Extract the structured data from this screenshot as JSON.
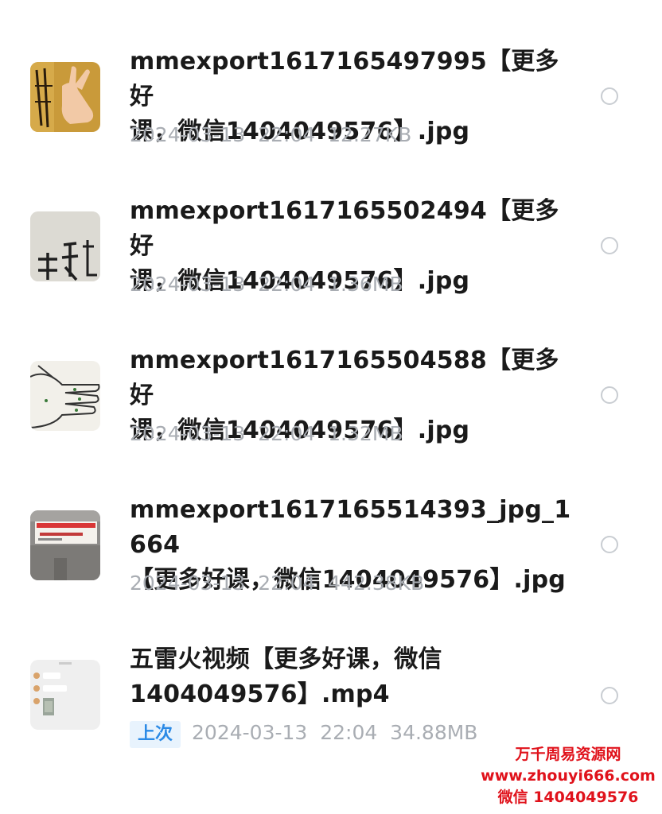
{
  "files": [
    {
      "name_line1": "mmexport1617165497995【更多好",
      "name_line2": "课，微信1404049576】.jpg",
      "date": "2024-03-13",
      "time": "22:04",
      "size": "12.27KB",
      "thumb_icon": "hand-gesture-thumbnail"
    },
    {
      "name_line1": "mmexport1617165502494【更多好",
      "name_line2": "课，微信1404049576】.jpg",
      "date": "2024-03-13",
      "time": "22:04",
      "size": "1.36MB",
      "thumb_icon": "calligraphy-thumbnail"
    },
    {
      "name_line1": "mmexport1617165504588【更多好",
      "name_line2": "课，微信1404049576】.jpg",
      "date": "2024-03-13",
      "time": "22:04",
      "size": "1.32MB",
      "thumb_icon": "hand-drawing-thumbnail"
    },
    {
      "name_line1": "mmexport1617165514393_jpg_1664",
      "name_line2": "【更多好课，微信1404049576】.jpg",
      "date": "2024-03-13",
      "time": "22:04",
      "size": "442.38KB",
      "thumb_icon": "banner-photo-thumbnail"
    },
    {
      "name_line1": "五雷火视频【更多好课，微信",
      "name_line2": "1404049576】.mp4",
      "badge": "上次",
      "date": "2024-03-13",
      "time": "22:04",
      "size": "34.88MB",
      "thumb_icon": "chat-screenshot-thumbnail"
    }
  ],
  "watermark": {
    "line1": "万千周易资源网",
    "line2": "www.zhouyi666.com",
    "line3": "微信 1404049576"
  },
  "colors": {
    "title": "#1a1a1a",
    "meta": "#a9adb3",
    "badge_bg": "#e8f3fd",
    "badge_text": "#2b8ae6",
    "watermark": "#e0121b"
  }
}
